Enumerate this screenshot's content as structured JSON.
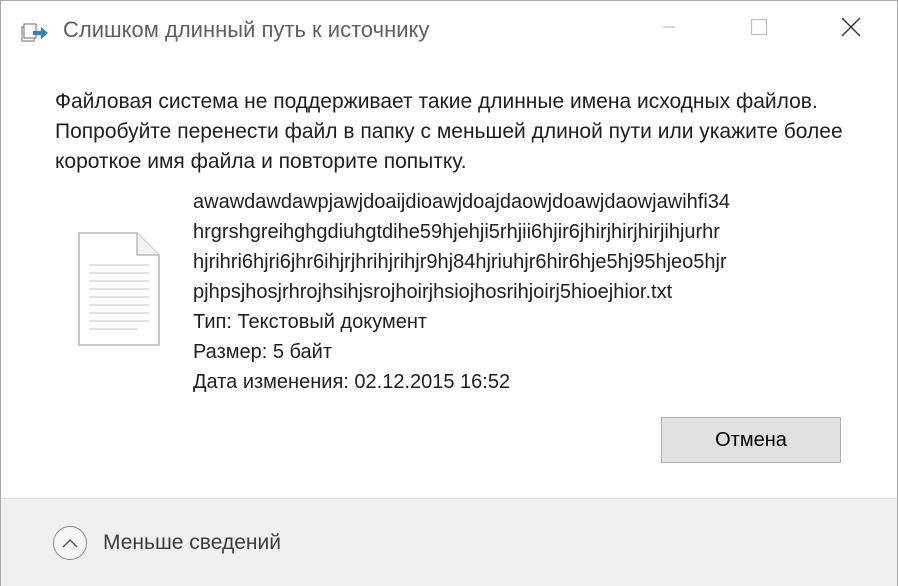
{
  "window": {
    "title": "Слишком длинный путь к источнику"
  },
  "message": "Файловая система не поддерживает такие длинные имена исходных файлов. Попробуйте перенести файл в папку с меньшей длиной пути или укажите более короткое имя файла и повторите попытку.",
  "file": {
    "icon": "text-document-icon",
    "name_lines": [
      "awawdawdawpjawjdoaijdioawjdoajdaowjdoawjdaowjawihfi34",
      "hrgrshgreihghgdiuhgtdihe59hjehji5rhjii6hjir6jhirjhirjhirjihjurhr",
      "hjrihri6hjri6jhr6ihjrjhrihjrihjr9hj84hjriuhjr6hir6hje5hj95hjeo5hjr",
      "pjhpsjhosjrhrojhsihjsrojhoirjhsiojhosrihjoirj5hioejhior.txt"
    ],
    "type": "Тип: Текстовый документ",
    "size": "Размер: 5 байт",
    "modified": "Дата изменения: 02.12.2015 16:52"
  },
  "buttons": {
    "cancel": "Отмена"
  },
  "footer": {
    "details_label": "Меньше сведений",
    "details_icon": "chevron-up-icon"
  },
  "colors": {
    "title_text": "#5f5f5f",
    "button_bg": "#e1e1e1",
    "footer_bg": "#f0f0f0"
  }
}
